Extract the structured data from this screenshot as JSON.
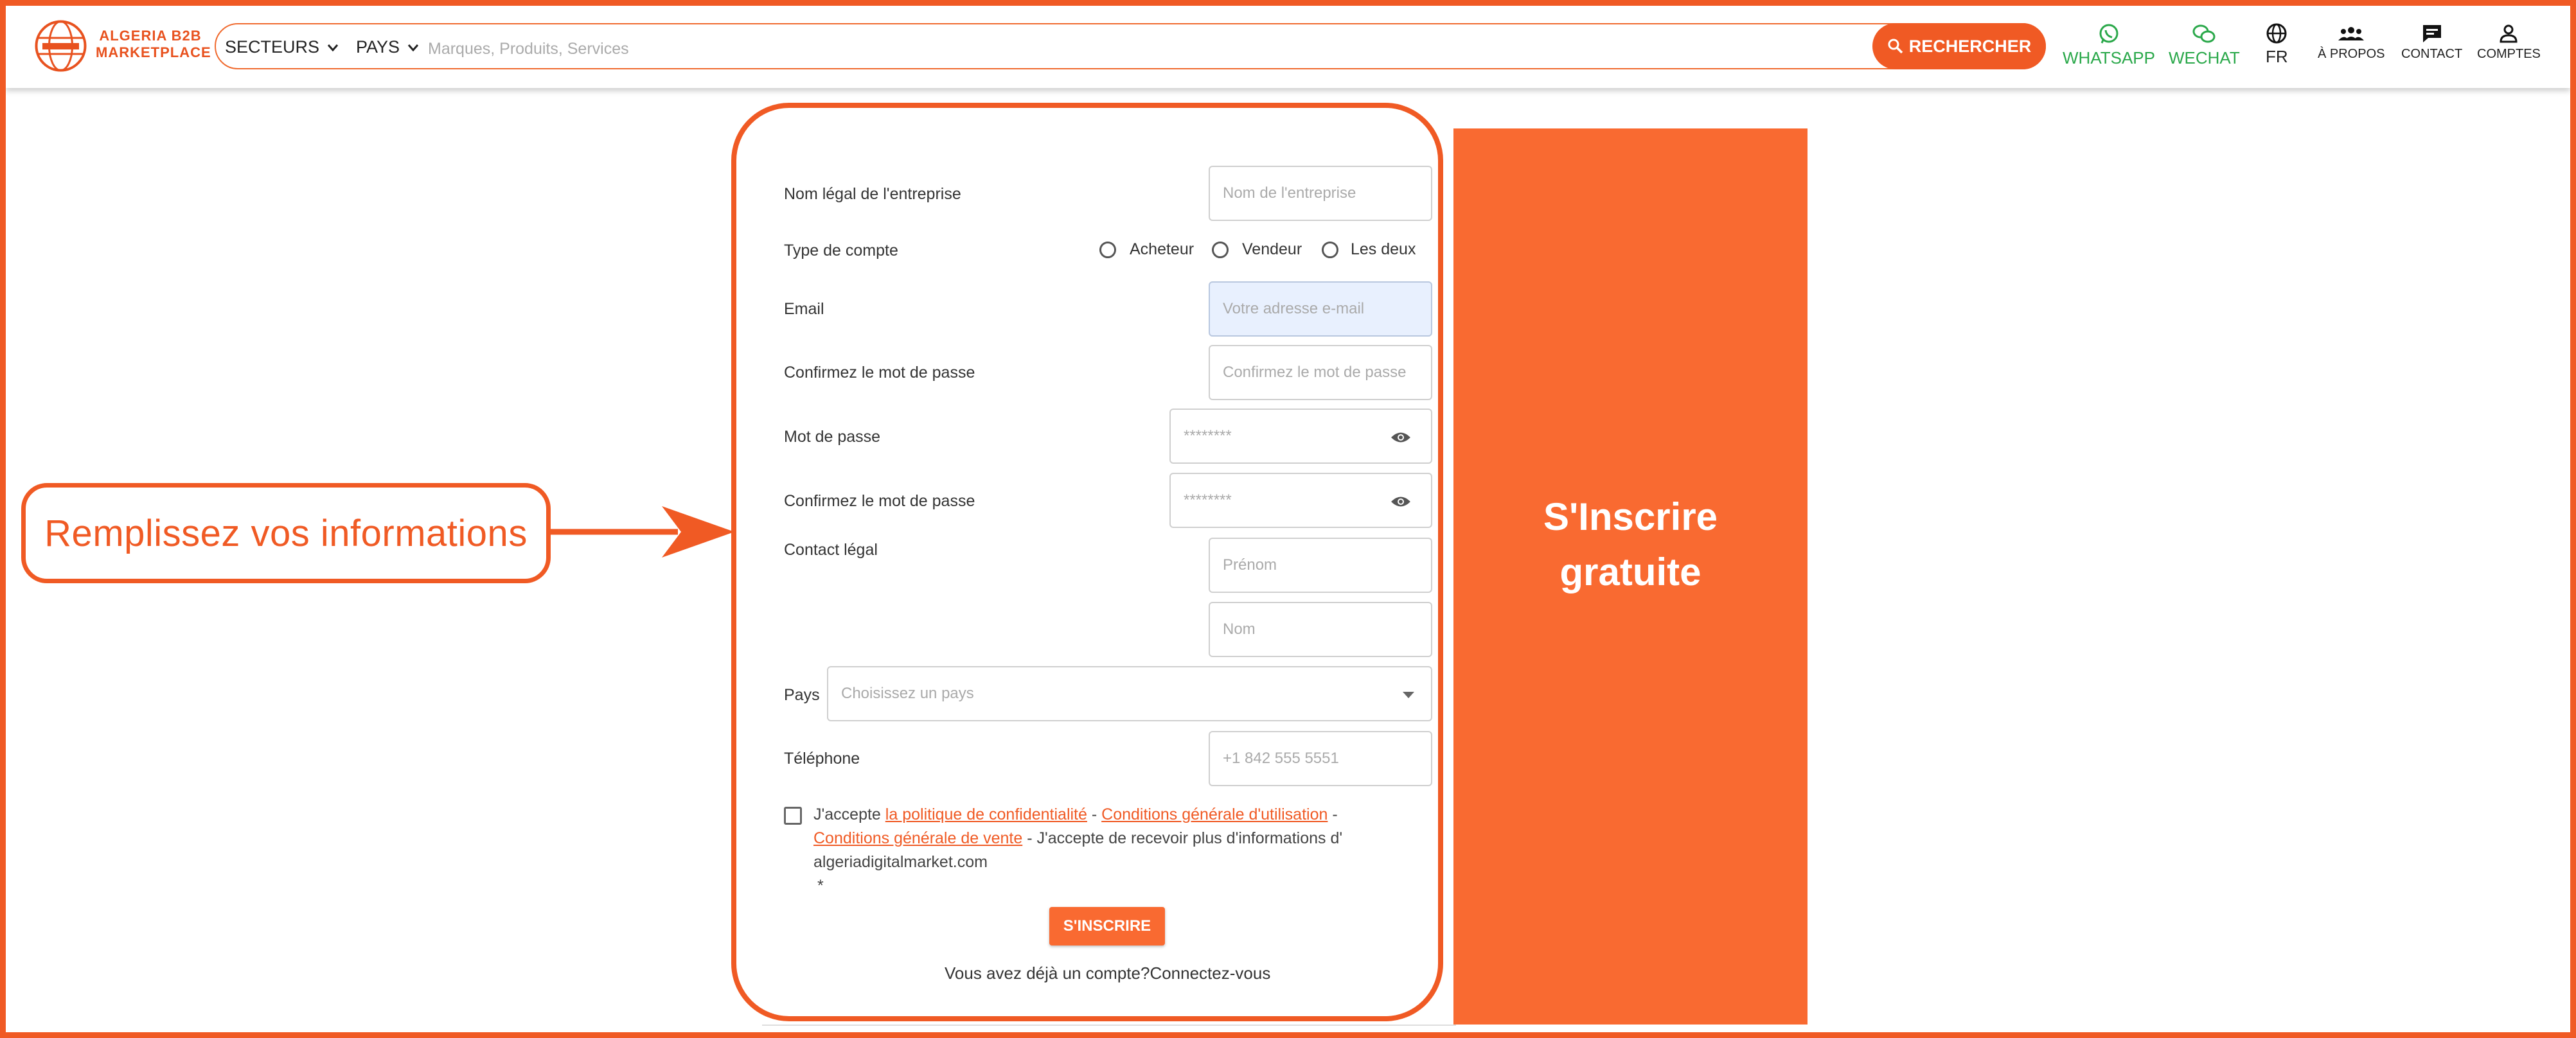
{
  "header": {
    "logo_text": "ALGERIA B2B MARKETPLACE",
    "sectors_label": "SECTEURS",
    "countries_label": "PAYS",
    "search_placeholder": "Marques, Produits, Services",
    "search_button": "RECHERCHER",
    "whatsapp": "WHATSAPP",
    "wechat": "WECHAT",
    "language": "FR",
    "about": "À PROPOS",
    "contact": "CONTACT",
    "accounts": "COMPTES"
  },
  "form": {
    "company_label": "Nom légal de l'entreprise",
    "company_placeholder": "Nom de l'entreprise",
    "account_type_label": "Type de compte",
    "account_types": [
      "Acheteur",
      "Vendeur",
      "Les deux"
    ],
    "email_label": "Email",
    "email_placeholder": "Votre adresse e-mail",
    "confirm_label_1": "Confirmez le mot de passe",
    "confirm_placeholder_1": "Confirmez le mot de passe",
    "password_label": "Mot de passe",
    "password_value": "********",
    "confirm_label_2": "Confirmez le mot de passe",
    "confirm_value_2": "********",
    "contact_label": "Contact légal",
    "first_name_placeholder": "Prénom",
    "last_name_placeholder": "Nom",
    "country_label": "Pays",
    "country_placeholder": "Choisissez un pays",
    "phone_label": "Téléphone",
    "phone_placeholder": "+1 842 555 5551",
    "terms": {
      "prefix": "J'accepte",
      "privacy_link": "la politique de confidentialité",
      "sep1": "-",
      "terms_use_link": "Conditions générale d'utilisation",
      "sep2": "-",
      "terms_sale_link": "Conditions générale de vente",
      "sep3": "-",
      "newsletter": "J'accepte de recevoir plus d'informations d' algeriadigitalmarket.com",
      "required_mark": "*"
    },
    "submit_button": "S'INSCRIRE",
    "login_prompt": "Vous avez déjà un compte?Connectez-vous"
  },
  "promo": {
    "text": "S'Inscrire gratuite"
  },
  "callout": {
    "text": "Remplissez vos informations"
  },
  "colors": {
    "brand": "#f05a24",
    "promo_bg": "#f96a31",
    "green": "#2aa84a",
    "email_bg": "#e8f0fe"
  },
  "icons": [
    "logo-globe-icon",
    "chevron-down-icon",
    "search-icon",
    "whatsapp-icon",
    "wechat-icon",
    "globe-icon",
    "group-icon",
    "chat-icon",
    "person-icon",
    "eye-icon",
    "dropdown-caret-icon",
    "arrow-right-icon"
  ]
}
